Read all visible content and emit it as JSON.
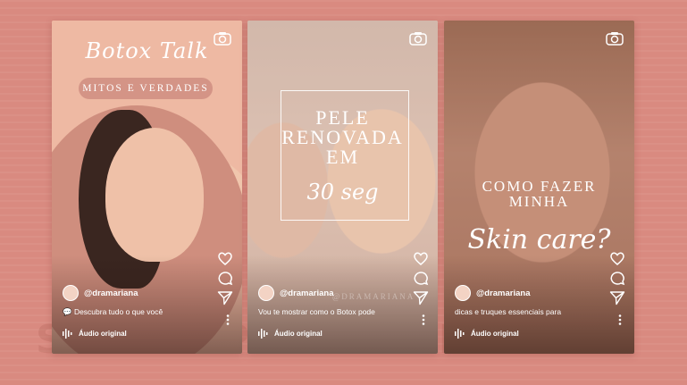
{
  "background": {
    "color": "#d98a80",
    "watermark": "SPEE SPEE SPEE SPEE"
  },
  "accent_colors": {
    "pill": "#d49486",
    "card1": "#eeb9a3"
  },
  "cards": [
    {
      "title_script": "Botox Talk",
      "badge": "MITOS E VERDADES",
      "username": "@dramariana",
      "caption": "💬 Descubra tudo o que você",
      "audio": "Áudio original"
    },
    {
      "title_caps": "PELE RENOVADA EM",
      "title_script": "30 seg",
      "brand_watermark": "@DRAMARIANA",
      "username": "@dramariana",
      "caption": "Vou te mostrar como o Botox pode",
      "audio": "Áudio original"
    },
    {
      "title_caps": "COMO FAZER MINHA",
      "title_script": "Skin care?",
      "username": "@dramariana",
      "caption": "dicas e truques essenciais para",
      "audio": "Áudio original"
    }
  ],
  "icons": [
    "camera-icon",
    "heart-icon",
    "comment-icon",
    "send-icon",
    "more-icon",
    "audio-wave-icon"
  ]
}
